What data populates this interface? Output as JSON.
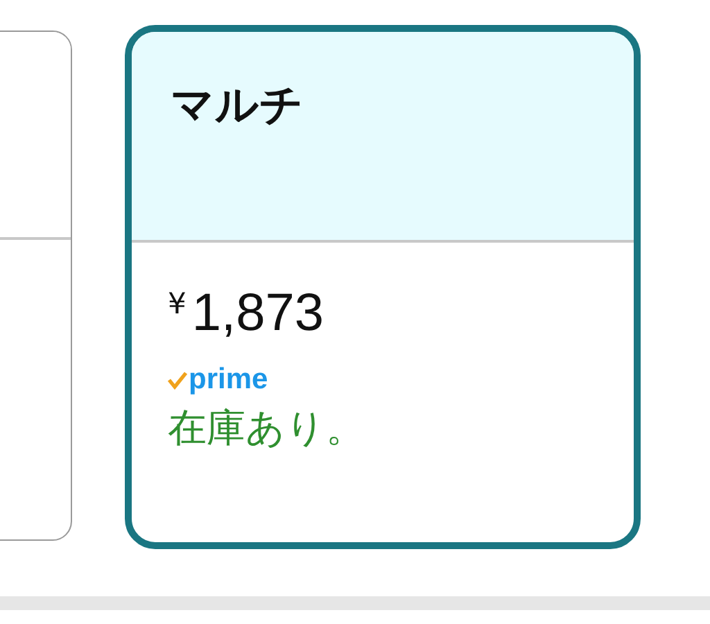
{
  "options": [
    {
      "selected": false
    },
    {
      "selected": true,
      "title": "マルチ",
      "currency": "¥",
      "price": "1,873",
      "prime_badge": "prime",
      "availability": "在庫あり。"
    }
  ]
}
